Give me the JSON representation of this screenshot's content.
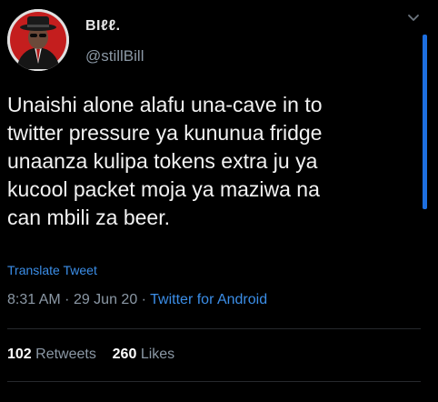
{
  "tweet": {
    "display_name": "BIℓℓ.",
    "handle": "@stillBill",
    "lines": [
      "Unaishi alone alafu una-cave in to",
      "twitter pressure ya kununua fridge",
      "unaanza kulipa tokens extra ju ya",
      "kucool packet moja ya maziwa na",
      "can mbili za beer."
    ],
    "translate_label": "Translate Tweet",
    "time": "8:31 AM",
    "separator": "·",
    "date": "29 Jun 20",
    "source": "Twitter for Android",
    "retweets_count": "102",
    "retweets_label": "Retweets",
    "likes_count": "260",
    "likes_label": "Likes"
  },
  "colors": {
    "background": "#000000",
    "text": "#f2f2f2",
    "secondary": "#8b98a5",
    "link": "#3b8ee8",
    "scrollbar": "#1d6fe0"
  },
  "icons": {
    "avatar": "avatar-photo",
    "more": "chevron-down-icon"
  }
}
